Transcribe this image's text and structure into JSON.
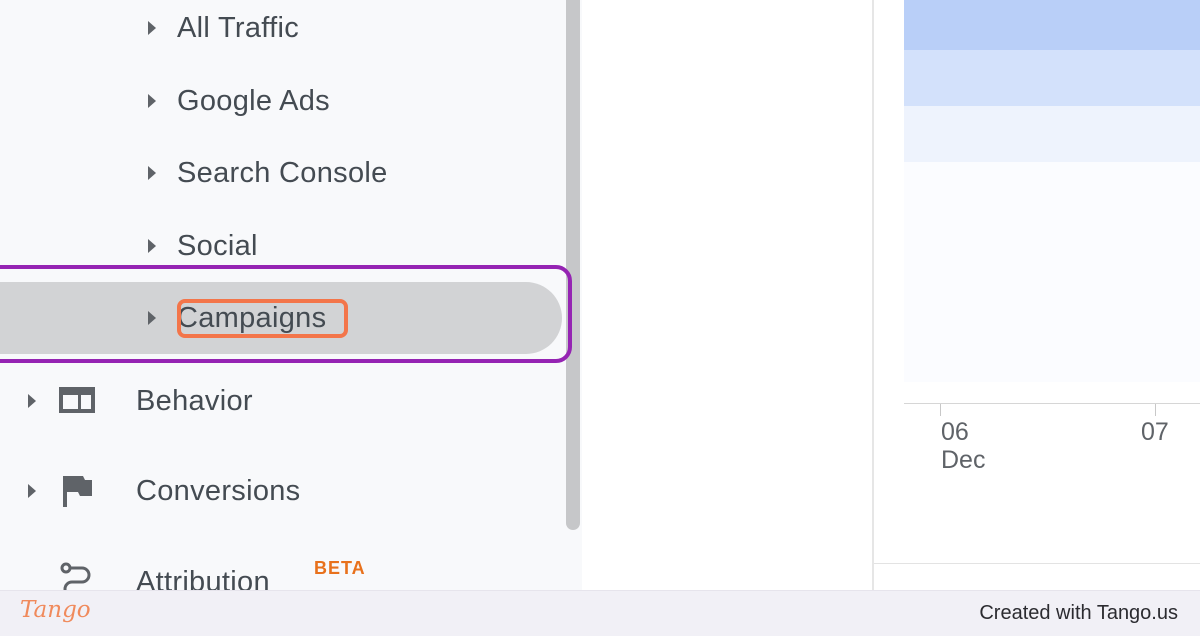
{
  "sidebar": {
    "sub_items": [
      {
        "label": "All Traffic"
      },
      {
        "label": "Google Ads"
      },
      {
        "label": "Search Console"
      },
      {
        "label": "Social"
      },
      {
        "label": "Campaigns"
      }
    ],
    "top_items": [
      {
        "label": "Behavior",
        "icon": "behavior-layout-icon"
      },
      {
        "label": "Conversions",
        "icon": "flag-icon"
      },
      {
        "label": "Attribution",
        "icon": "attribution-icon",
        "badge": "BETA"
      }
    ],
    "active_item": "Campaigns"
  },
  "chart": {
    "ticks": [
      {
        "day": "06",
        "month": "Dec"
      },
      {
        "day": "07",
        "month": ""
      }
    ]
  },
  "colors": {
    "focus_ring": "#9524b3",
    "highlight": "#f3754a",
    "badge": "#e8711c",
    "heat_dark": "#b9cff8",
    "heat_mid": "#d3e1fb"
  },
  "footer": {
    "brand": "Tango",
    "credit": "Created with Tango.us"
  }
}
